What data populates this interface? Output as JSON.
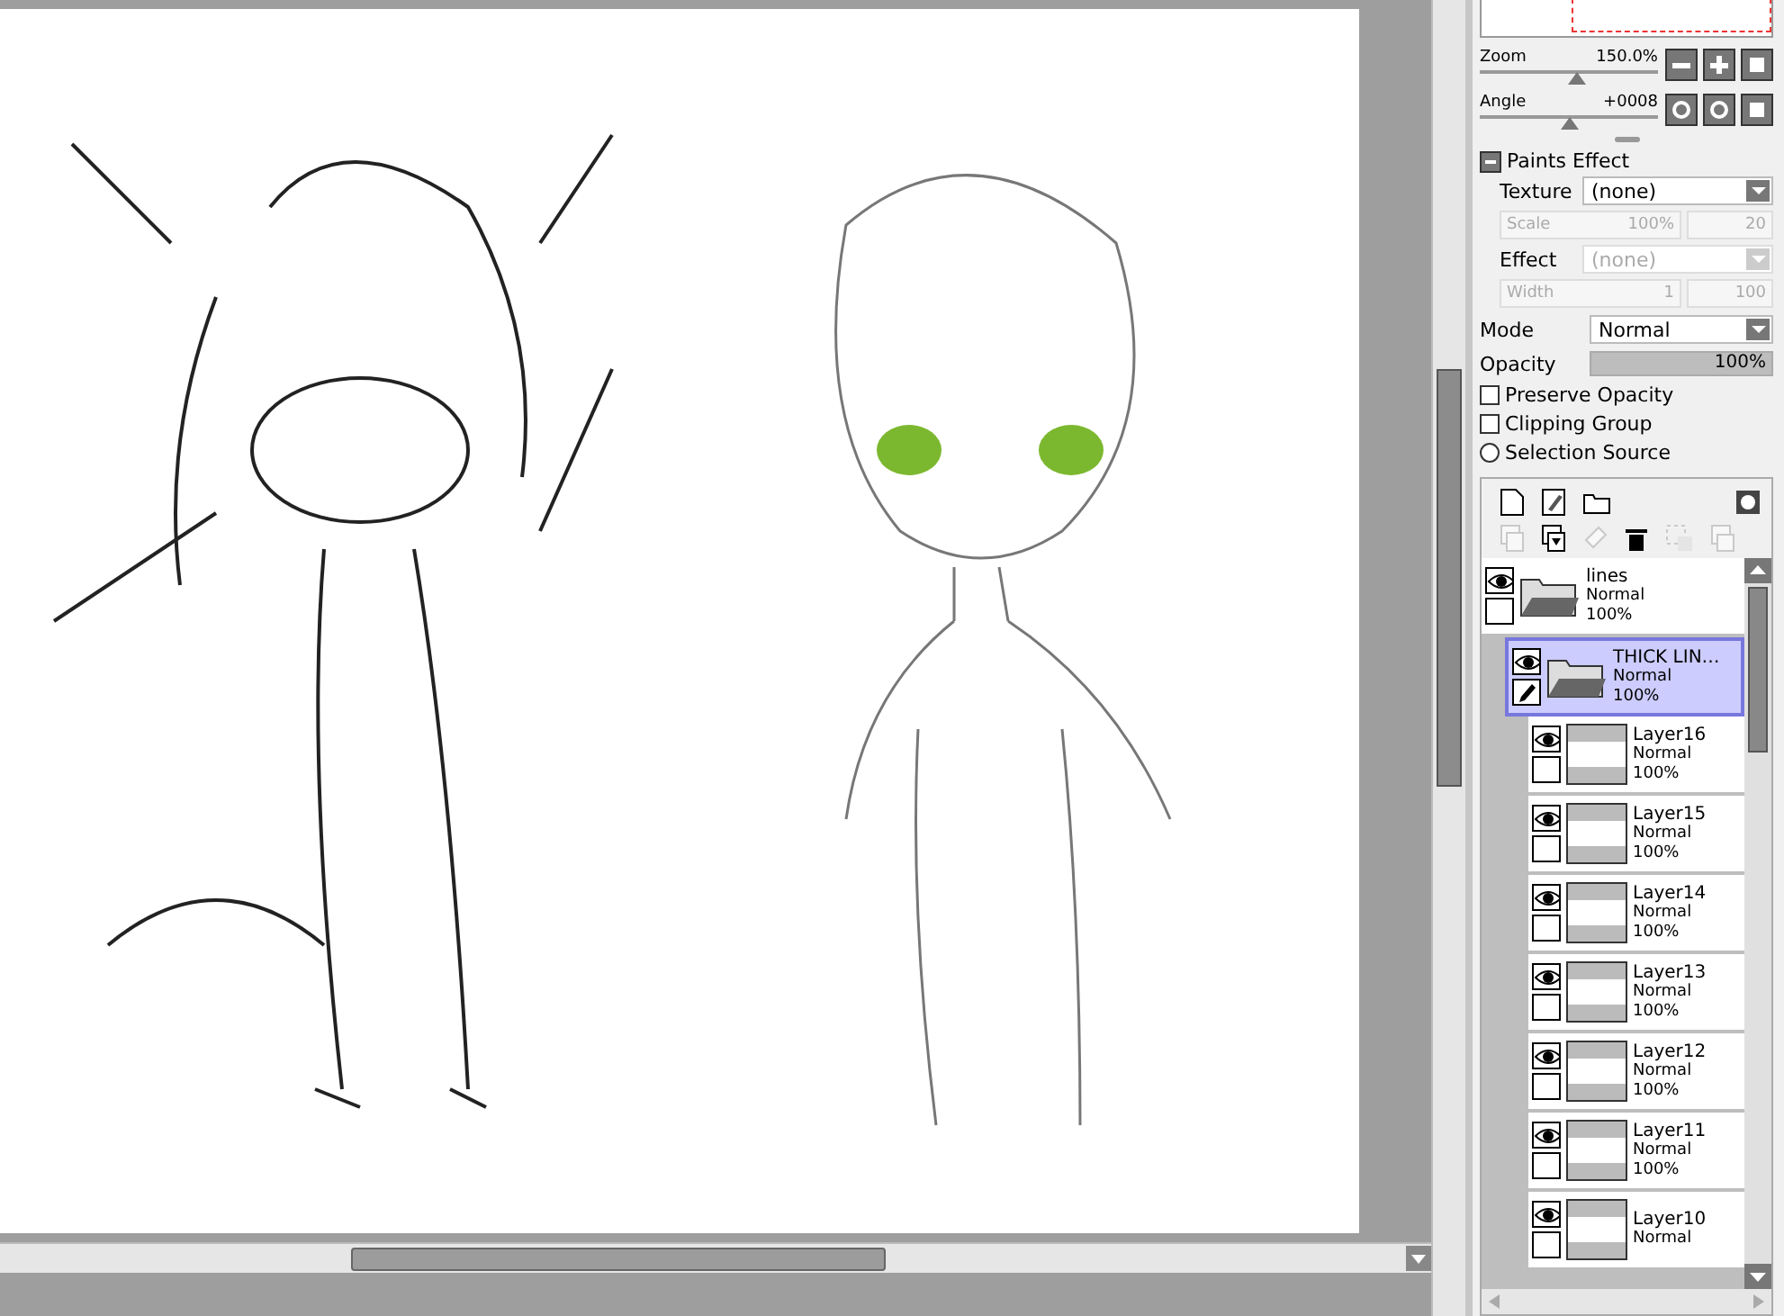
{
  "navigator": {
    "zoom": {
      "label": "Zoom",
      "value": "150.0%",
      "level": 0.55
    },
    "angle": {
      "label": "Angle",
      "value": "+0008",
      "level": 0.5
    }
  },
  "paints_effect": {
    "title": "Paints Effect",
    "expanded": true,
    "texture": {
      "label": "Texture",
      "value": "(none)"
    },
    "scale": {
      "label": "Scale",
      "value": "100%",
      "extra": "20",
      "disabled": true
    },
    "effect": {
      "label": "Effect",
      "value": "(none)",
      "disabled": true
    },
    "width": {
      "label": "Width",
      "value": "1",
      "extra": "100",
      "disabled": true
    }
  },
  "mode": {
    "label": "Mode",
    "value": "Normal"
  },
  "opacity": {
    "label": "Opacity",
    "value": "100%",
    "level": 1
  },
  "options": [
    {
      "kind": "checkbox",
      "label": "Preserve Opacity",
      "checked": false
    },
    {
      "kind": "checkbox",
      "label": "Clipping Group",
      "checked": false
    },
    {
      "kind": "radio",
      "label": "Selection Source",
      "checked": false
    }
  ],
  "layers": [
    {
      "kind": "folder",
      "name": "lines",
      "mode": "Normal",
      "opacity": "100%",
      "visible": true,
      "selected": false,
      "children": [
        {
          "kind": "folder",
          "name": "THICK LIN…",
          "mode": "Normal",
          "opacity": "100%",
          "visible": true,
          "selected": true,
          "children": [
            {
              "kind": "layer",
              "name": "Layer16",
              "mode": "Normal",
              "opacity": "100%",
              "visible": true,
              "selected": false
            },
            {
              "kind": "layer",
              "name": "Layer15",
              "mode": "Normal",
              "opacity": "100%",
              "visible": true,
              "selected": false
            },
            {
              "kind": "layer",
              "name": "Layer14",
              "mode": "Normal",
              "opacity": "100%",
              "visible": true,
              "selected": false
            },
            {
              "kind": "layer",
              "name": "Layer13",
              "mode": "Normal",
              "opacity": "100%",
              "visible": true,
              "selected": false
            },
            {
              "kind": "layer",
              "name": "Layer12",
              "mode": "Normal",
              "opacity": "100%",
              "visible": true,
              "selected": false
            },
            {
              "kind": "layer",
              "name": "Layer11",
              "mode": "Normal",
              "opacity": "100%",
              "visible": true,
              "selected": false
            },
            {
              "kind": "layer",
              "name": "Layer10",
              "mode": "Normal",
              "visible": true,
              "selected": false
            }
          ]
        }
      ]
    }
  ]
}
